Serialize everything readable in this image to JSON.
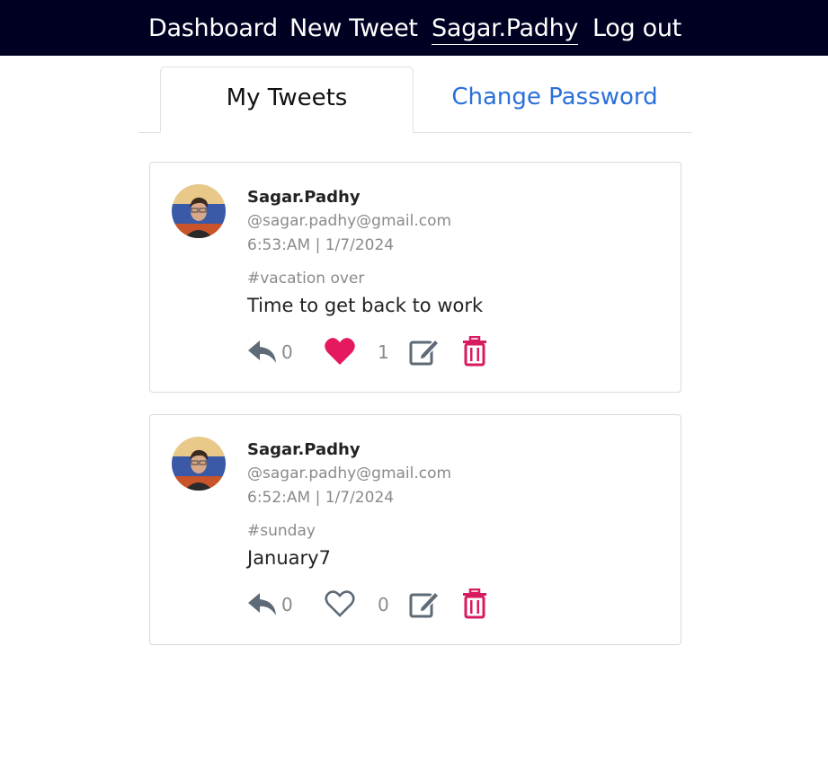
{
  "nav": {
    "items": [
      {
        "label": "Dashboard"
      },
      {
        "label": "New Tweet"
      },
      {
        "label": "Sagar.Padhy"
      },
      {
        "label": "Log out"
      }
    ]
  },
  "tabs": [
    {
      "label": "My Tweets",
      "active": true
    },
    {
      "label": "Change Password",
      "active": false
    }
  ],
  "tweets": [
    {
      "name": "Sagar.Padhy",
      "handle": "@sagar.padhy@gmail.com",
      "time": "6:53:AM | 1/7/2024",
      "tag": "#vacation over",
      "text": "Time to get back to work",
      "replies": "0",
      "likes": "1",
      "liked": true
    },
    {
      "name": "Sagar.Padhy",
      "handle": "@sagar.padhy@gmail.com",
      "time": "6:52:AM | 1/7/2024",
      "tag": "#sunday",
      "text": "January7",
      "replies": "0",
      "likes": "0",
      "liked": false
    }
  ],
  "colors": {
    "navbar": "#000022",
    "link": "#2a6fdb",
    "like": "#e5195f",
    "delete": "#d81b60",
    "icon": "#5e6a75"
  }
}
